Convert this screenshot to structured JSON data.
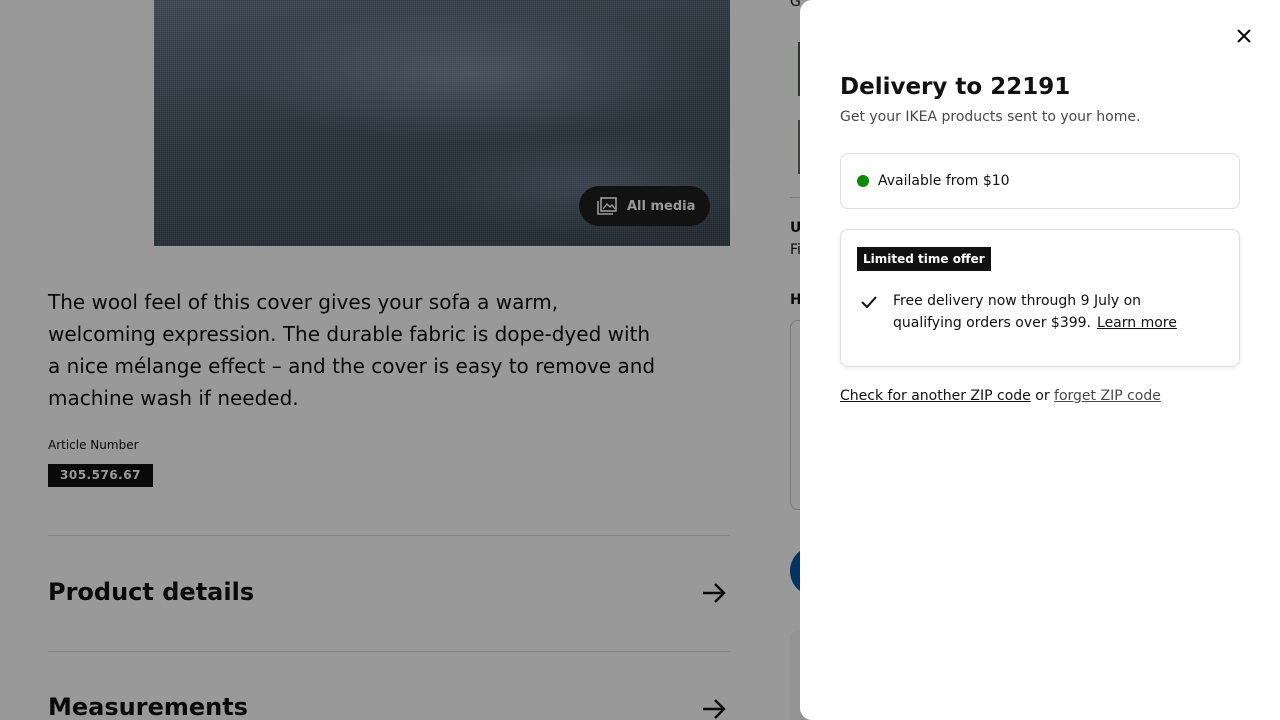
{
  "background_page": {
    "all_media_label": "All media",
    "description": "The wool feel of this cover gives your sofa a warm, welcoming expression. The durable fabric is dope-dyed with a nice mélange effect – and the cover is easy to remove and machine wash if needed.",
    "article_label": "Article Number",
    "article_number": "305.576.67",
    "accordions": [
      {
        "label": "Product details"
      },
      {
        "label": "Measurements"
      }
    ],
    "right_column_fragments": [
      "G",
      "U",
      "Fi",
      "H"
    ]
  },
  "delivery_sheet": {
    "title": "Delivery to 22191",
    "subtitle": "Get your IKEA products sent to your home.",
    "availability": {
      "text": "Available from $10",
      "status_color": "#0a8a00"
    },
    "offer": {
      "badge": "Limited time offer",
      "text": "Free delivery now through 9 July on qualifying orders over $399.",
      "link": "Learn more"
    },
    "zip_actions": {
      "check_link": "Check for another ZIP code",
      "separator": "or",
      "forget_link": "forget ZIP code"
    },
    "close_icon": "close-icon"
  },
  "colors": {
    "scrim": "rgba(0,0,0,0.4)",
    "badge_bg": "#111111",
    "available": "#0a8a00"
  }
}
